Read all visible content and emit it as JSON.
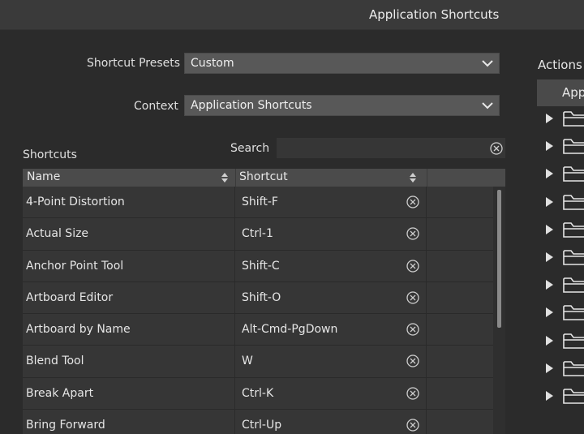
{
  "window": {
    "title": "Application Shortcuts"
  },
  "presets": {
    "label": "Shortcut Presets",
    "value": "Custom"
  },
  "context": {
    "label": "Context",
    "value": "Application Shortcuts"
  },
  "shortcuts_label": "Shortcuts",
  "search": {
    "label": "Search",
    "value": "",
    "placeholder": ""
  },
  "table": {
    "columns": [
      "Name",
      "Shortcut"
    ],
    "rows": [
      {
        "name": "4-Point Distortion",
        "shortcut": "Shift-F"
      },
      {
        "name": "Actual Size",
        "shortcut": "Ctrl-1"
      },
      {
        "name": "Anchor Point Tool",
        "shortcut": "Shift-C"
      },
      {
        "name": "Artboard Editor",
        "shortcut": "Shift-O"
      },
      {
        "name": "Artboard by Name",
        "shortcut": "Alt-Cmd-PgDown"
      },
      {
        "name": "Blend Tool",
        "shortcut": "W"
      },
      {
        "name": "Break Apart",
        "shortcut": "Ctrl-K"
      },
      {
        "name": "Bring Forward",
        "shortcut": "Ctrl-Up"
      }
    ]
  },
  "actions": {
    "title": "Actions",
    "header": "App",
    "folder_count": 11
  },
  "icons": {
    "dropdown": "chevron-down-icon",
    "clear": "circle-x-icon",
    "sort": "sort-arrows-icon",
    "expand": "triangle-right-icon",
    "folder": "folder-icon"
  },
  "colors": {
    "background": "#2b2b2b",
    "titlebar": "#3a3a3a",
    "dropdown": "#585858",
    "table_header": "#4b4b4b",
    "row": "#363636"
  }
}
